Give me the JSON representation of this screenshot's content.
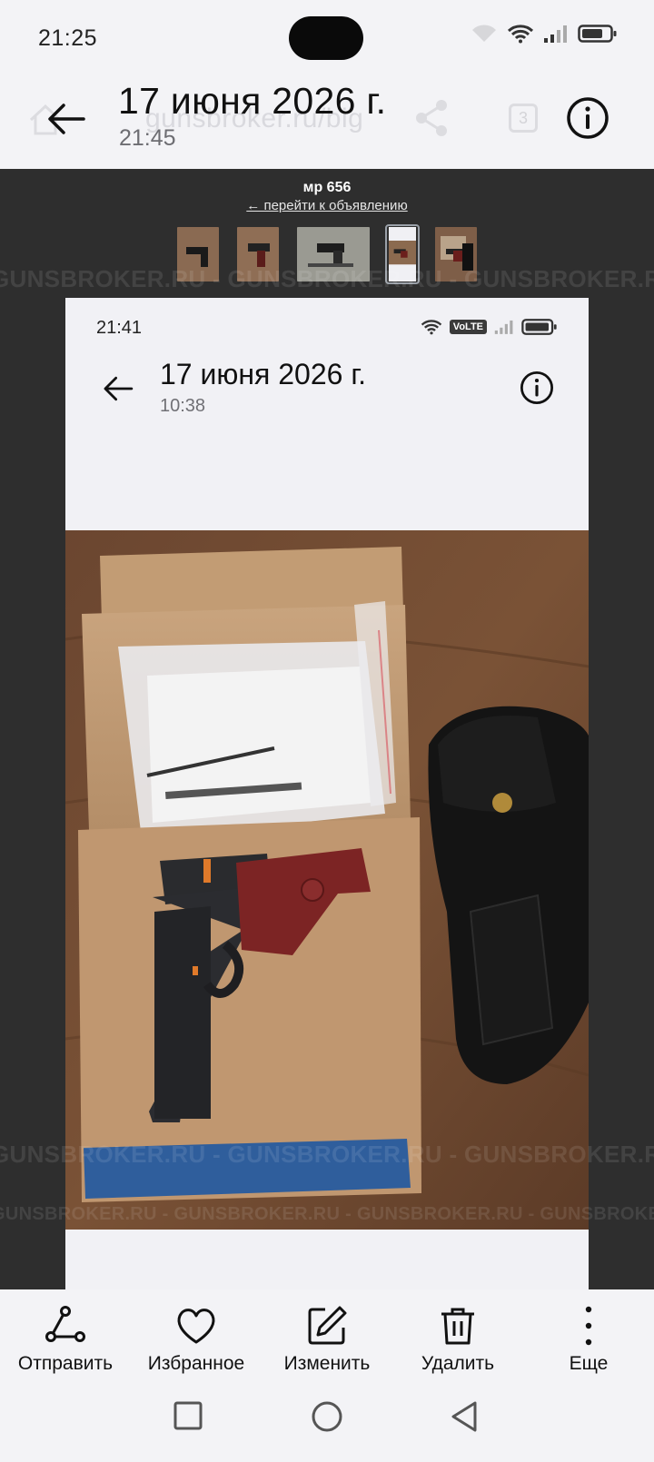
{
  "status_bar": {
    "time": "21:25"
  },
  "header": {
    "background_url": "gunsbroker.ru/big",
    "background_tab_count": "3",
    "date": "17 июня 2026 г.",
    "time": "21:45"
  },
  "viewer": {
    "title": "мр 656",
    "link": "← перейти к объявлению",
    "watermark": "GUNSBROKER.RU - GUNSBROKER.RU - GUNSBROKER.RU - GUNSBROKER.RU",
    "thumbnail_count": 5,
    "selected_thumbnail": 4
  },
  "inner_screenshot": {
    "status_time": "21:41",
    "network_badge": "VoLTE",
    "date": "17 июня 2026 г.",
    "time": "10:38"
  },
  "toolbar": {
    "send": "Отправить",
    "favorite": "Избранное",
    "edit": "Изменить",
    "delete": "Удалить",
    "more": "Еще"
  },
  "colors": {
    "viewer_background": "#2e2e2e",
    "chrome_background": "#f3f3f6",
    "text_primary": "#111111",
    "text_secondary": "#6d6d72"
  }
}
